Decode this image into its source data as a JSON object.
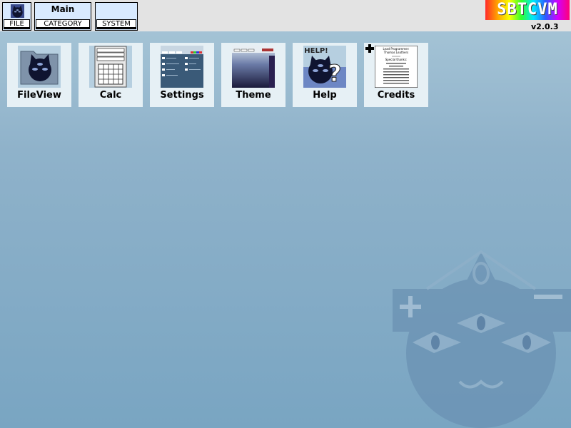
{
  "topbar": {
    "file_label": "FILE",
    "main_label": "Main",
    "category_label": "CATEGORY",
    "system_label": "SYSTEM",
    "logo_text": "SBTCVM",
    "version": "v2.0.3"
  },
  "apps": [
    {
      "label": "FileView",
      "icon": "folder-cat-icon"
    },
    {
      "label": "Calc",
      "icon": "calculator-icon"
    },
    {
      "label": "Settings",
      "icon": "settings-preview-icon"
    },
    {
      "label": "Theme",
      "icon": "theme-preview-icon"
    },
    {
      "label": "Help",
      "icon": "help-icon",
      "badge": "HELP!"
    },
    {
      "label": "Credits",
      "icon": "credits-document-icon",
      "doc_lines": [
        "Lead Programmer:",
        "Thomas Leathers",
        "Special thanks:"
      ]
    }
  ],
  "colors": {
    "desktop_top": "#a9c7d8",
    "desktop_bottom": "#79a5c2",
    "button_bg": "#d8eaff",
    "topbar_bg": "#e3e3e3",
    "tile_bg": "#e6f0f5"
  }
}
